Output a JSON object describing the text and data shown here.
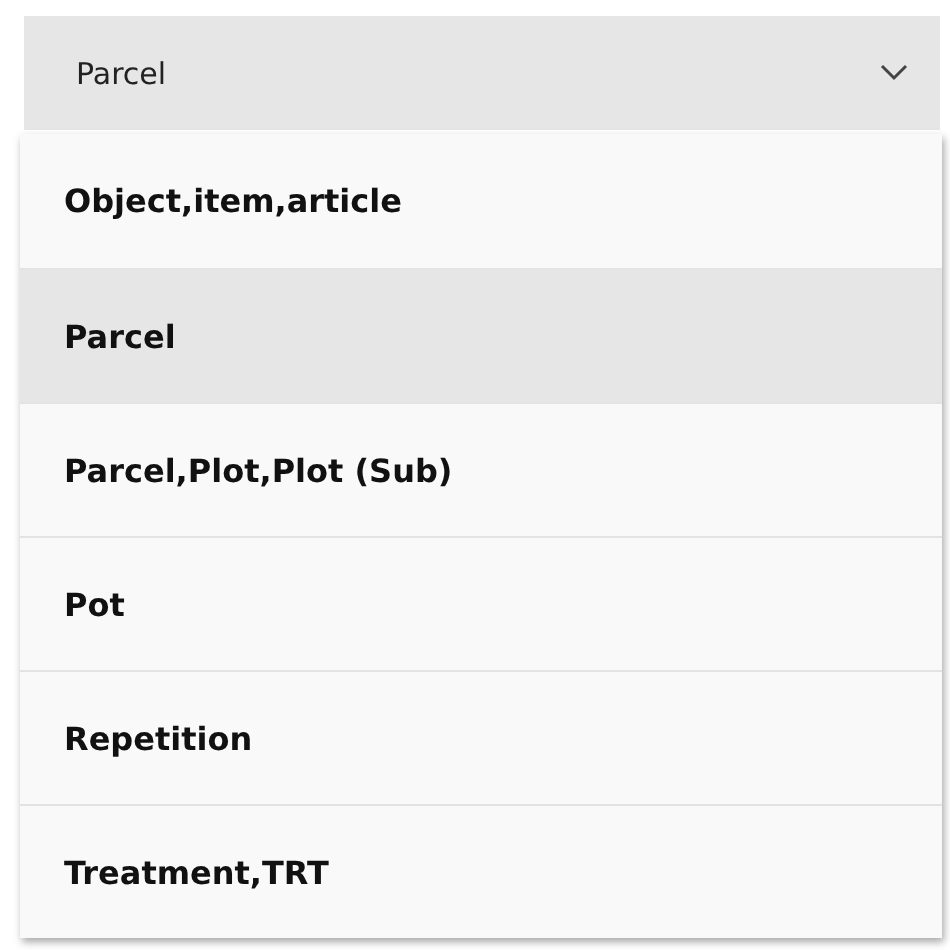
{
  "combobox": {
    "value": "Parcel"
  },
  "options": [
    {
      "label": "Object,item,article",
      "selected": false
    },
    {
      "label": "Parcel",
      "selected": true
    },
    {
      "label": "Parcel,Plot,Plot (Sub)",
      "selected": false
    },
    {
      "label": "Pot",
      "selected": false
    },
    {
      "label": "Repetition",
      "selected": false
    },
    {
      "label": "Treatment,TRT",
      "selected": false
    }
  ]
}
